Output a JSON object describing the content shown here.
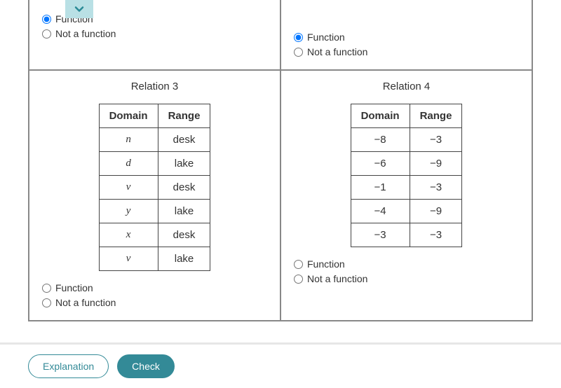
{
  "dropdown_icon": "chevron-down",
  "options": {
    "function": "Function",
    "not_function": "Not a function"
  },
  "table_headers": {
    "domain": "Domain",
    "range": "Range"
  },
  "relation1": {
    "selected": "function"
  },
  "relation2": {
    "selected": "function"
  },
  "relation3": {
    "title": "Relation 3",
    "rows": [
      {
        "d": "n",
        "r": "desk"
      },
      {
        "d": "d",
        "r": "lake"
      },
      {
        "d": "v",
        "r": "desk"
      },
      {
        "d": "y",
        "r": "lake"
      },
      {
        "d": "x",
        "r": "desk"
      },
      {
        "d": "v",
        "r": "lake"
      }
    ],
    "selected": null
  },
  "relation4": {
    "title": "Relation 4",
    "rows": [
      {
        "d": "−8",
        "r": "−3"
      },
      {
        "d": "−6",
        "r": "−9"
      },
      {
        "d": "−1",
        "r": "−3"
      },
      {
        "d": "−4",
        "r": "−9"
      },
      {
        "d": "−3",
        "r": "−3"
      }
    ],
    "selected": null
  },
  "buttons": {
    "explanation": "Explanation",
    "check": "Check"
  }
}
